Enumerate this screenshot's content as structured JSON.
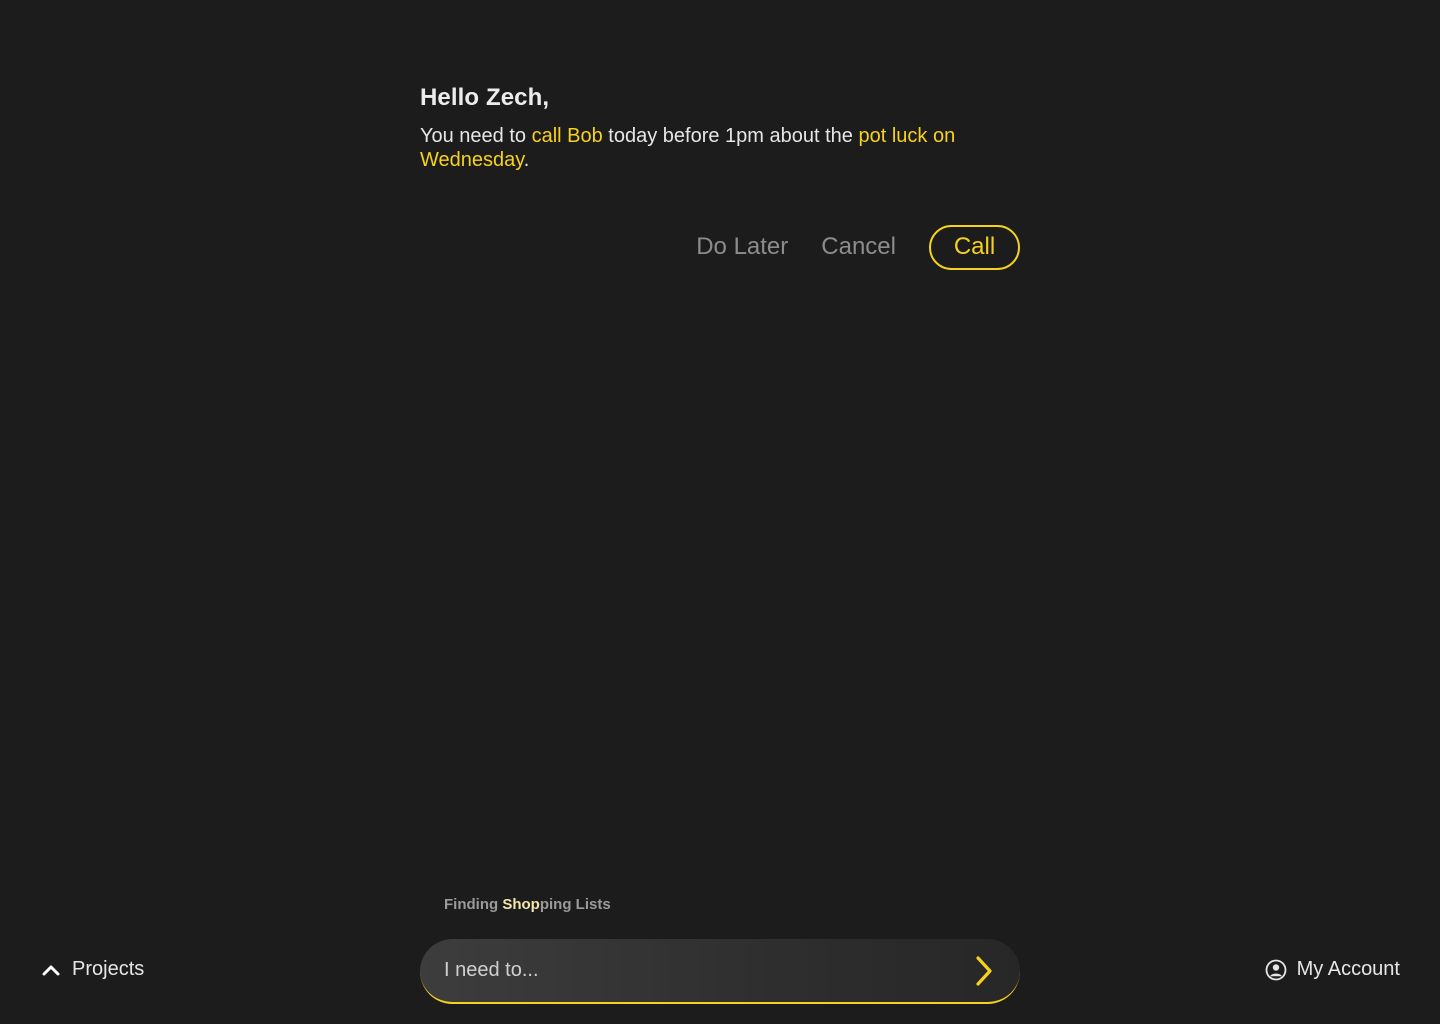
{
  "message": {
    "greeting": "Hello Zech,",
    "parts": {
      "p1": "You need to ",
      "h1": "call Bob",
      "p2": " today before 1pm about the ",
      "h2": "pot luck on Wednesday",
      "p3": "."
    }
  },
  "actions": {
    "do_later_label": "Do Later",
    "cancel_label": "Cancel",
    "call_label": "Call"
  },
  "status": {
    "pre": "Finding ",
    "highlight": "Shop",
    "post": "ping Lists"
  },
  "composer": {
    "placeholder": "I need to..."
  },
  "nav": {
    "projects_label": "Projects",
    "account_label": "My Account"
  },
  "icons": {
    "send": "chevron-right-icon",
    "projects": "chevron-up-icon",
    "account": "user-circle-icon"
  },
  "colors": {
    "background": "#1c1c1c",
    "accent": "#f7d21c",
    "muted": "#8c8c8c"
  }
}
